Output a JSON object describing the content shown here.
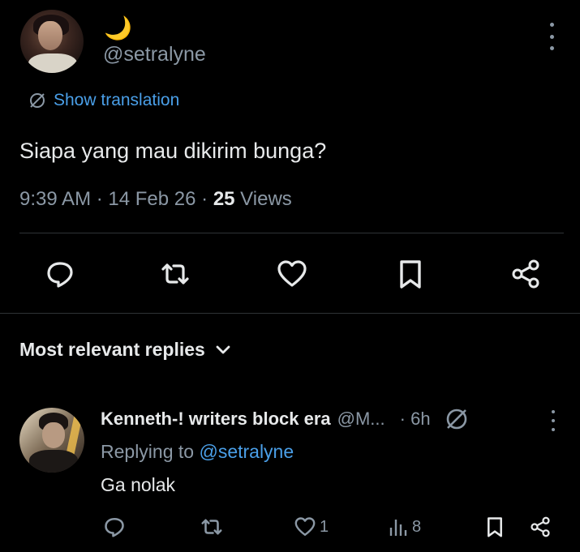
{
  "tweet": {
    "display_name": "🌙",
    "handle": "@setralyne",
    "show_translation": "Show translation",
    "text": "Siapa yang mau dikirim bunga?",
    "time": "9:39 AM",
    "sep1": " · ",
    "date": "14 Feb 26",
    "sep2": " · ",
    "views_count": "25",
    "views_label": " Views"
  },
  "actions_main": {
    "reply_icon": "reply-icon",
    "retweet_icon": "retweet-icon",
    "like_icon": "heart-icon",
    "bookmark_icon": "bookmark-icon",
    "share_icon": "share-icon"
  },
  "replies": {
    "header_label": "Most relevant replies",
    "items": [
      {
        "name": "Kenneth-! writers block era",
        "handle": "@M...",
        "time": "· 6h",
        "replying_prefix": "Replying to ",
        "replying_mention": "@setralyne",
        "text": "Ga nolak",
        "likes": "1",
        "views": "8"
      }
    ]
  },
  "colors": {
    "background": "#000000",
    "text_primary": "#e7e9ea",
    "text_secondary": "#8b98a5",
    "link": "#4a9fe8",
    "divider": "#2f3336",
    "moon": "#f5c542"
  }
}
